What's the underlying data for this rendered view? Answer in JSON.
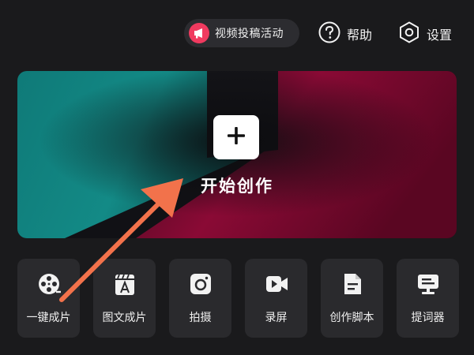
{
  "topbar": {
    "promo_label": "视频投稿活动",
    "help_label": "帮助",
    "settings_label": "设置"
  },
  "hero": {
    "label": "开始创作"
  },
  "tools": [
    {
      "label": "一键成片",
      "icon": "film-reel-icon"
    },
    {
      "label": "图文成片",
      "icon": "clapperboard-text-icon"
    },
    {
      "label": "拍摄",
      "icon": "camera-icon"
    },
    {
      "label": "录屏",
      "icon": "screen-record-icon"
    },
    {
      "label": "创作脚本",
      "icon": "script-document-icon"
    },
    {
      "label": "提词器",
      "icon": "teleprompter-icon"
    }
  ],
  "colors": {
    "background": "#1a1a1c",
    "accent_pink": "#f03a5f",
    "hero_teal": "#138a86",
    "hero_crimson": "#8a0a35",
    "annotation_arrow": "#f2724b"
  }
}
